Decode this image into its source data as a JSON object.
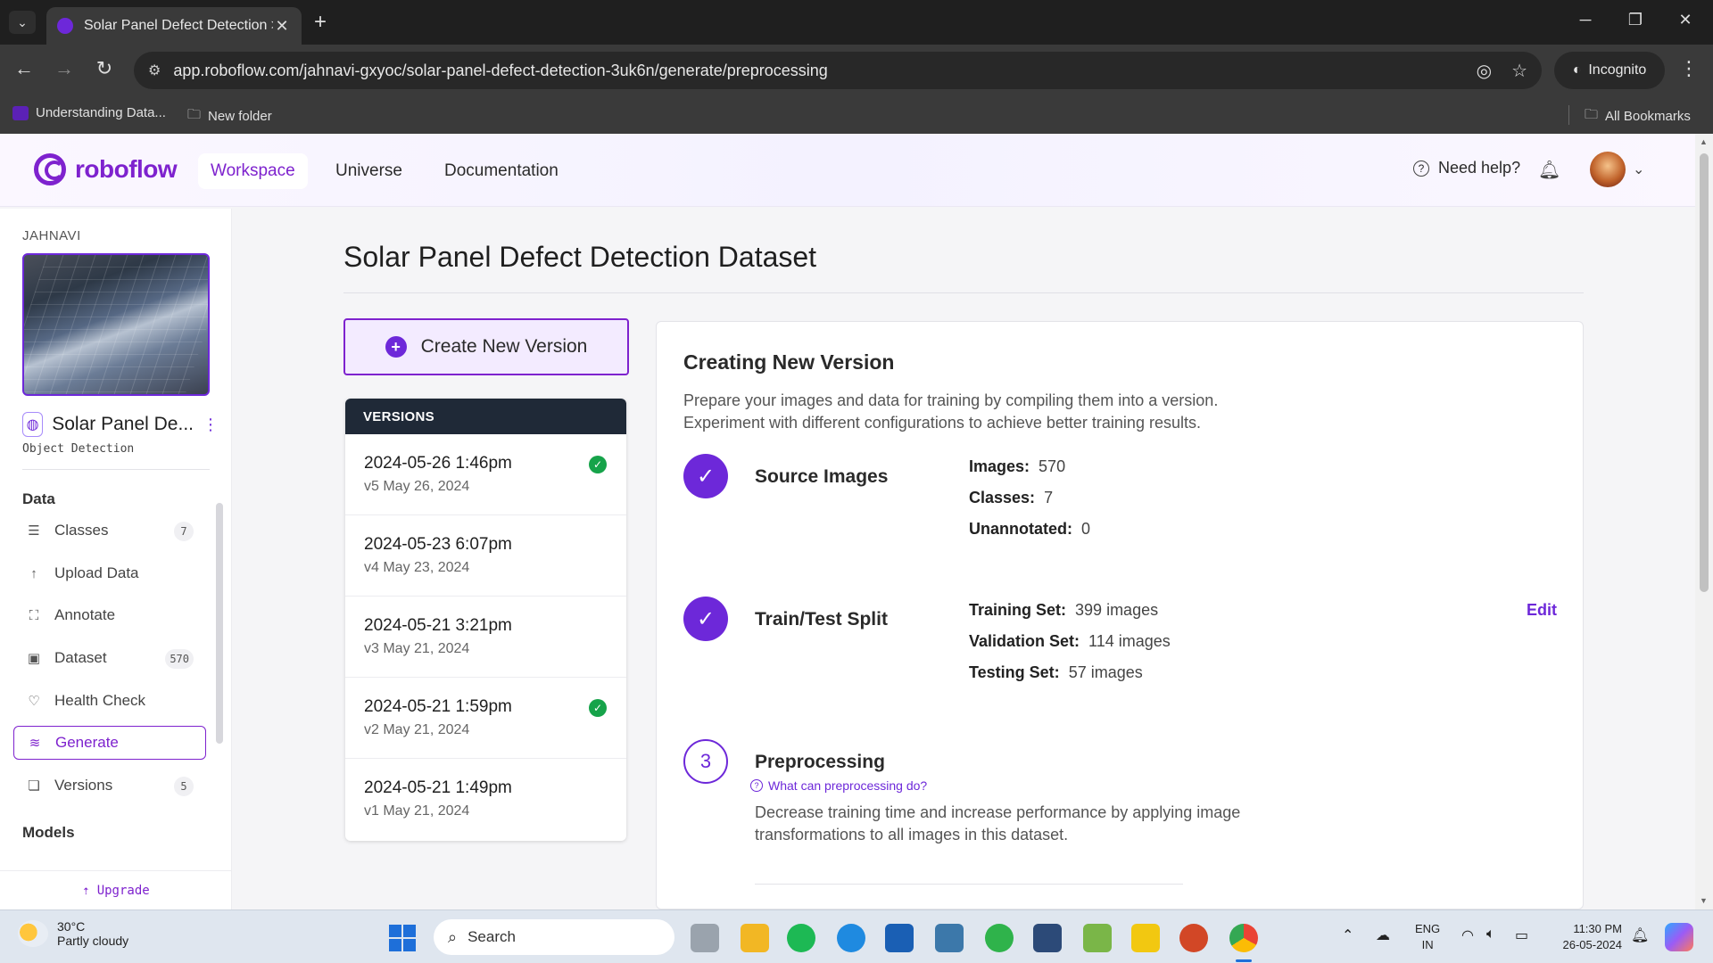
{
  "browser": {
    "tab_title": "Solar Panel Defect Detection > ",
    "url": "app.roboflow.com/jahnavi-gxyoc/solar-panel-defect-detection-3uk6n/generate/preprocessing",
    "incognito_label": "Incognito",
    "bookmarks": [
      "Understanding Data...",
      "New folder"
    ],
    "all_bookmarks": "All Bookmarks"
  },
  "app": {
    "logo_text": "roboflow",
    "nav": [
      "Workspace",
      "Universe",
      "Documentation"
    ],
    "help_label": "Need help?"
  },
  "sidebar": {
    "workspace": "JAHNAVI",
    "project_name": "Solar Panel De...",
    "project_type": "Object Detection",
    "data_section": "Data",
    "items": [
      {
        "label": "Classes",
        "badge": "7",
        "icon": "list-icon"
      },
      {
        "label": "Upload Data",
        "badge": "",
        "icon": "upload-arrow-icon"
      },
      {
        "label": "Annotate",
        "badge": "",
        "icon": "annotate-icon"
      },
      {
        "label": "Dataset",
        "badge": "570",
        "icon": "images-icon"
      },
      {
        "label": "Health Check",
        "badge": "",
        "icon": "heart-pulse-icon"
      },
      {
        "label": "Generate",
        "badge": "",
        "icon": "generate-icon"
      },
      {
        "label": "Versions",
        "badge": "5",
        "icon": "versions-icon"
      }
    ],
    "models_section": "Models",
    "upgrade_label": "Upgrade"
  },
  "main": {
    "title": "Solar Panel Defect Detection Dataset",
    "create_button": "Create New Version",
    "versions_header": "VERSIONS",
    "versions": [
      {
        "date": "2024-05-26 1:46pm",
        "sub": "v5 May 26, 2024",
        "trained": true
      },
      {
        "date": "2024-05-23 6:07pm",
        "sub": "v4 May 23, 2024",
        "trained": false
      },
      {
        "date": "2024-05-21 3:21pm",
        "sub": "v3 May 21, 2024",
        "trained": false
      },
      {
        "date": "2024-05-21 1:59pm",
        "sub": "v2 May 21, 2024",
        "trained": true
      },
      {
        "date": "2024-05-21 1:49pm",
        "sub": "v1 May 21, 2024",
        "trained": false
      }
    ],
    "panel": {
      "title": "Creating New Version",
      "desc1": "Prepare your images and data for training by compiling them into a version.",
      "desc2": "Experiment with different configurations to achieve better training results.",
      "source": {
        "title": "Source Images",
        "images_label": "Images:",
        "images_value": "570",
        "classes_label": "Classes:",
        "classes_value": "7",
        "unannotated_label": "Unannotated:",
        "unannotated_value": "0"
      },
      "split": {
        "title": "Train/Test Split",
        "edit": "Edit",
        "train_label": "Training Set:",
        "train_value": "399 images",
        "valid_label": "Validation Set:",
        "valid_value": "114 images",
        "test_label": "Testing Set:",
        "test_value": "57 images"
      },
      "preprocessing": {
        "step": "3",
        "title": "Preprocessing",
        "help_link": "What can preprocessing do?",
        "desc1": "Decrease training time and increase performance by applying image",
        "desc2": "transformations to all images in this dataset."
      }
    }
  },
  "taskbar": {
    "temp": "30°C",
    "weather": "Partly cloudy",
    "search": "Search",
    "lang1": "ENG",
    "lang2": "IN",
    "time": "11:30 PM",
    "date": "26-05-2024"
  },
  "colors": {
    "brand": "#7e22ce",
    "success": "#16a34a",
    "versions_header": "#1f2937"
  }
}
